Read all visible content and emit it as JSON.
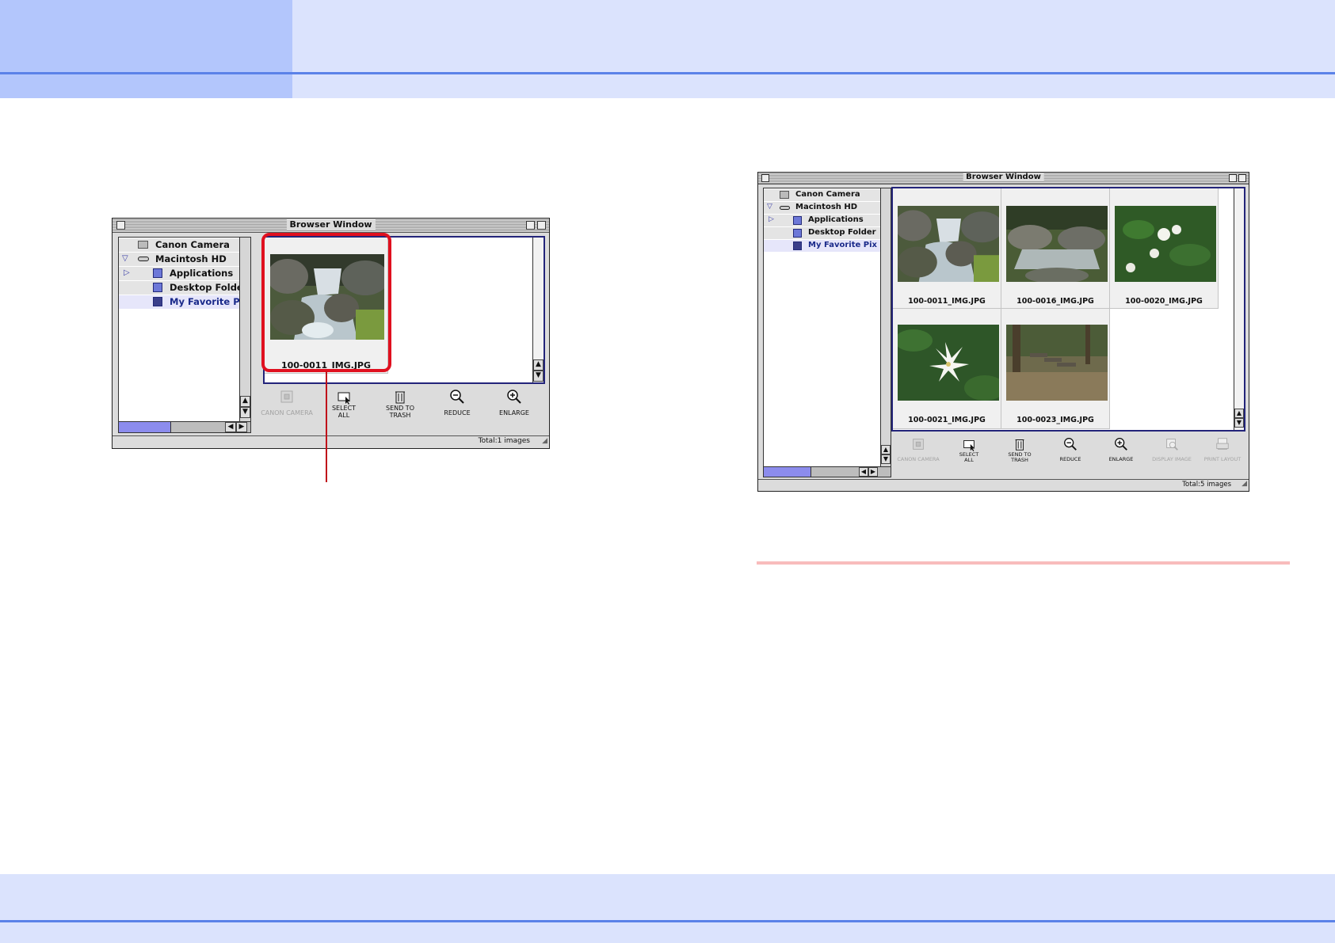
{
  "colors": {
    "header_dark": "#b3c6fc",
    "header_light": "#dbe3fd",
    "header_line": "#5b82e8",
    "callout": "#e0101f",
    "divider": "#f8bcbc"
  },
  "window_left": {
    "title": "Browser Window",
    "tree": [
      {
        "label": "Canon Camera",
        "icon": "camera-icon"
      },
      {
        "label": "Macintosh HD",
        "icon": "hard-drive-icon"
      },
      {
        "label": "Applications",
        "icon": "folder-icon"
      },
      {
        "label": "Desktop Folder",
        "icon": "folder-icon"
      },
      {
        "label": "My Favorite Pix",
        "icon": "folder-icon"
      }
    ],
    "images": [
      "100-0011_IMG.JPG"
    ],
    "toolbar": [
      {
        "label": "CANON CAMERA",
        "icon": "camera-icon",
        "enabled": false
      },
      {
        "label": "SELECT\nALL",
        "icon": "select-all-icon",
        "enabled": true
      },
      {
        "label": "SEND TO\nTRASH",
        "icon": "trash-icon",
        "enabled": true
      },
      {
        "label": "REDUCE",
        "icon": "zoom-out-icon",
        "enabled": true
      },
      {
        "label": "ENLARGE",
        "icon": "zoom-in-icon",
        "enabled": true
      }
    ],
    "status": "Total:1 images"
  },
  "window_right": {
    "title": "Browser Window",
    "tree": [
      {
        "label": "Canon Camera",
        "icon": "camera-icon"
      },
      {
        "label": "Macintosh HD",
        "icon": "hard-drive-icon"
      },
      {
        "label": "Applications",
        "icon": "folder-icon"
      },
      {
        "label": "Desktop Folder",
        "icon": "folder-icon"
      },
      {
        "label": "My Favorite Pix",
        "icon": "folder-icon"
      }
    ],
    "images": [
      "100-0011_IMG.JPG",
      "100-0016_IMG.JPG",
      "100-0020_IMG.JPG",
      "100-0021_IMG.JPG",
      "100-0023_IMG.JPG"
    ],
    "toolbar": [
      {
        "label": "CANON CAMERA",
        "icon": "camera-icon",
        "enabled": false
      },
      {
        "label": "SELECT\nALL",
        "icon": "select-all-icon",
        "enabled": true
      },
      {
        "label": "SEND TO\nTRASH",
        "icon": "trash-icon",
        "enabled": true
      },
      {
        "label": "REDUCE",
        "icon": "zoom-out-icon",
        "enabled": true
      },
      {
        "label": "ENLARGE",
        "icon": "zoom-in-icon",
        "enabled": true
      },
      {
        "label": "DISPLAY IMAGE",
        "icon": "display-image-icon",
        "enabled": false
      },
      {
        "label": "PRINT LAYOUT",
        "icon": "print-layout-icon",
        "enabled": false
      }
    ],
    "status": "Total:5 images"
  }
}
